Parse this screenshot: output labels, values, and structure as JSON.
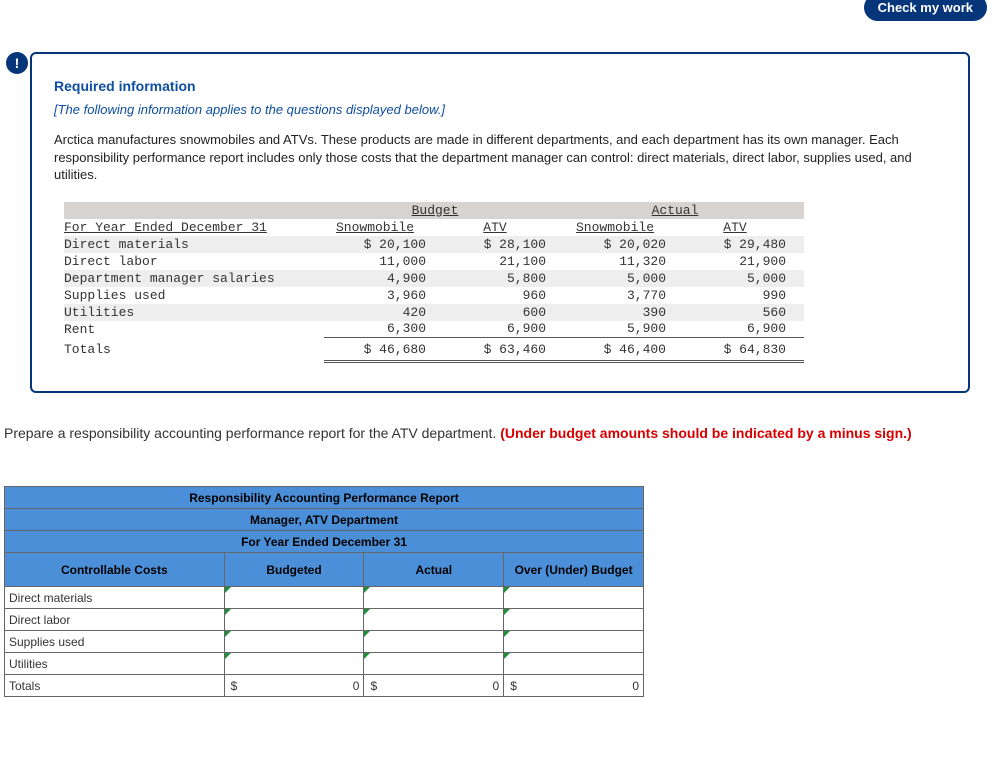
{
  "topButton": "Check my work",
  "exclamation": "!",
  "info": {
    "title": "Required information",
    "note": "[The following information applies to the questions displayed below.]",
    "body": "Arctica manufactures snowmobiles and ATVs. These products are made in different departments, and each department has its own manager. Each responsibility performance report includes only those costs that the department manager can control: direct materials, direct labor, supplies used, and utilities."
  },
  "dtable": {
    "period": "For Year Ended December 31",
    "h_budget": "Budget",
    "h_actual": "Actual",
    "h_snow": "Snowmobile",
    "h_atv": "ATV",
    "rows": [
      {
        "label": "Direct materials",
        "bs": "$ 20,100",
        "ba": "$ 28,100",
        "as": "$ 20,020",
        "aa": "$ 29,480"
      },
      {
        "label": "Direct labor",
        "bs": "11,000",
        "ba": "21,100",
        "as": "11,320",
        "aa": "21,900"
      },
      {
        "label": "Department manager salaries",
        "bs": "4,900",
        "ba": "5,800",
        "as": "5,000",
        "aa": "5,000"
      },
      {
        "label": "Supplies used",
        "bs": "3,960",
        "ba": "960",
        "as": "3,770",
        "aa": "990"
      },
      {
        "label": "Utilities",
        "bs": "420",
        "ba": "600",
        "as": "390",
        "aa": "560"
      },
      {
        "label": "Rent",
        "bs": "6,300",
        "ba": "6,900",
        "as": "5,900",
        "aa": "6,900"
      }
    ],
    "totalLabel": "Totals",
    "totals": {
      "bs": "$ 46,680",
      "ba": "$ 63,460",
      "as": "$ 46,400",
      "aa": "$ 64,830"
    }
  },
  "instruction": {
    "main": "Prepare a responsibility accounting performance report for the ATV department. ",
    "red": "(Under budget amounts should be indicated by a minus sign.)"
  },
  "ans": {
    "t1": "Responsibility Accounting Performance Report",
    "t2": "Manager, ATV Department",
    "t3": "For Year Ended December 31",
    "h_cc": "Controllable Costs",
    "h_bud": "Budgeted",
    "h_act": "Actual",
    "h_ovr": "Over (Under) Budget",
    "rows": [
      "Direct materials",
      "Direct labor",
      "Supplies used",
      "Utilities"
    ],
    "totLabel": "Totals",
    "cur": "$",
    "zero": "0"
  }
}
